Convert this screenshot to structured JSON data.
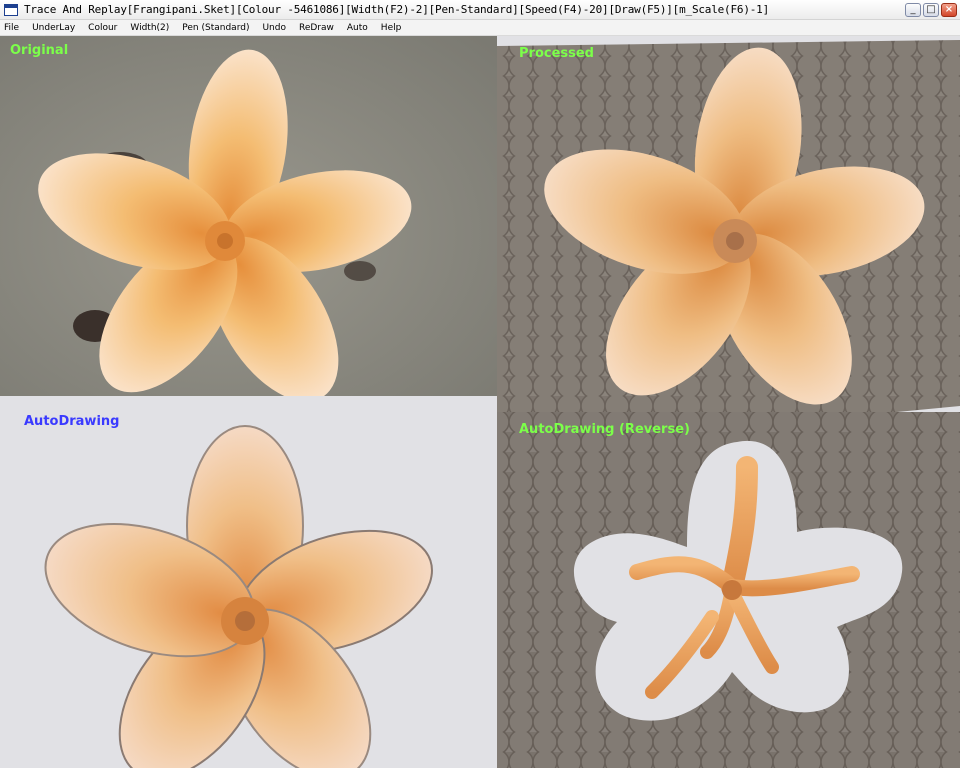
{
  "window": {
    "title": "Trace And Replay[Frangipani.Sket][Colour -5461086][Width(F2)-2][Pen-Standard][Speed(F4)-20][Draw(F5)][m_Scale(F6)-1]",
    "controls": {
      "minimize": "_",
      "maximize": "□",
      "close": "×"
    }
  },
  "menu": {
    "items": [
      "File",
      "UnderLay",
      "Colour",
      "Width(2)",
      "Pen (Standard)",
      "Undo",
      "ReDraw",
      "Auto",
      "Help"
    ]
  },
  "panels": {
    "original": {
      "label": "Original",
      "label_color": "#7cff4a"
    },
    "processed": {
      "label": "Processed",
      "label_color": "#7cff4a"
    },
    "autodrawing": {
      "label": "AutoDrawing",
      "label_color": "#3a3aff"
    },
    "reverse": {
      "label": "AutoDrawing (Reverse)",
      "label_color": "#7cff4a"
    }
  },
  "colors": {
    "background_grey": "#8d8b82",
    "stroke_dark": "#6f6860",
    "petal_light": "#f8dcc0",
    "petal_mid": "#f2b46a",
    "petal_core": "#e08a3a",
    "panel_bg": "#e1e1e5"
  },
  "icons": {
    "app": "window-icon",
    "minimize": "minimize-icon",
    "maximize": "maximize-icon",
    "close": "close-icon"
  }
}
